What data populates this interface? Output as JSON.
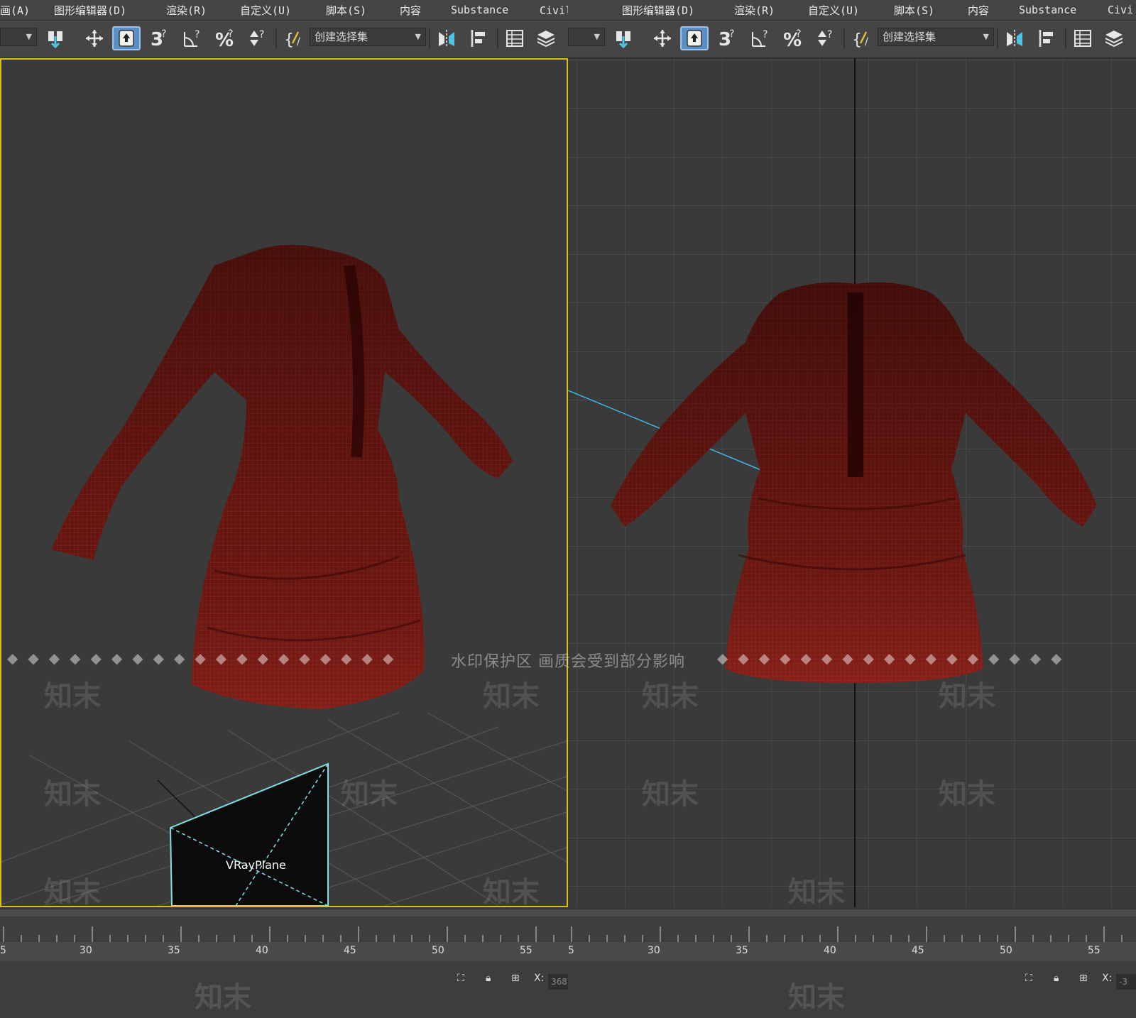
{
  "menu": {
    "items": [
      "画(A)",
      "图形编辑器(D)",
      "渲染(R)",
      "自定义(U)",
      "脚本(S)",
      "内容",
      "Substance",
      "Civil画(A)"
    ],
    "items_right": [
      "图形编辑器(D)",
      "渲染(R)",
      "自定义(U)",
      "脚本(S)",
      "内容",
      "Substance",
      "Civi"
    ]
  },
  "toolbar": {
    "selection_set_placeholder": "创建选择集",
    "snap_3_label": "3",
    "icons": [
      "select-move-icon",
      "move-icon",
      "select-region-icon",
      "snap-3d-icon",
      "angle-snap-icon",
      "percent-snap-icon",
      "spinner-snap-icon",
      "named-selection-icon",
      "mirror-icon",
      "align-icon",
      "scene-explorer-icon",
      "layer-icon"
    ]
  },
  "viewports": {
    "left": {
      "object_label": "VRayPlane",
      "view": "perspective"
    },
    "right": {
      "view": "front"
    }
  },
  "timeline": {
    "ticks_left": [
      "5",
      "30",
      "35",
      "40",
      "45",
      "50",
      "55"
    ],
    "ticks_right": [
      "5",
      "30",
      "35",
      "40",
      "45",
      "50",
      "55"
    ]
  },
  "statusbar": {
    "x_label": "X:",
    "x_value_left": "368",
    "x_value_right": "-3"
  },
  "watermark": {
    "banner": "水印保护区  画质会受到部分影响",
    "brand": "知末"
  },
  "colors": {
    "active_viewport_border": "#d7c21a",
    "dress": "#7a1a16",
    "grid": "#5c5c5c"
  }
}
